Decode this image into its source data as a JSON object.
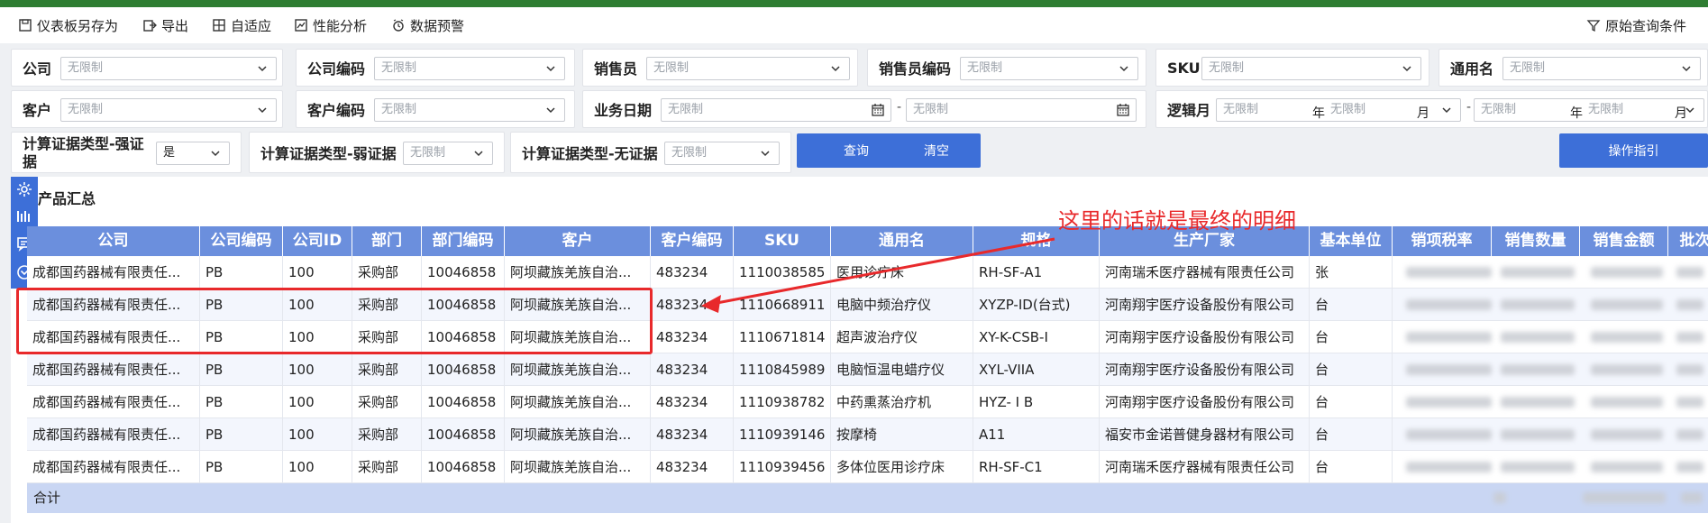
{
  "toolbar": {
    "save_dashboard": "仪表板另存为",
    "export": "导出",
    "adaptive": "自适应",
    "perf_analysis": "性能分析",
    "data_alert": "数据预警",
    "original_query": "原始查询条件"
  },
  "filters": {
    "placeholder": "无限制",
    "company": "公司",
    "company_code": "公司编码",
    "salesperson": "销售员",
    "salesperson_code": "销售员编码",
    "sku": "SKU",
    "generic_name": "通用名",
    "customer": "客户",
    "customer_code": "客户编码",
    "business_date": "业务日期",
    "logic_month": "逻辑月",
    "year_suffix": "年",
    "month_suffix": "月",
    "date_sep": "-",
    "strong_evidence_label_1": "计算证据类型-强证",
    "strong_evidence_label_2": "据",
    "strong_evidence_value": "是",
    "weak_evidence": "计算证据类型-弱证据",
    "no_evidence": "计算证据类型-无证据",
    "query_button": "查询",
    "clear_button": "清空",
    "guide_button": "操作指引"
  },
  "panel": {
    "title": "产品汇总",
    "columns": [
      "公司",
      "公司编码",
      "公司ID",
      "部门",
      "部门编码",
      "客户",
      "客户编码",
      "SKU",
      "通用名",
      "规格",
      "生产厂家",
      "基本单位",
      "销项税率",
      "销售数量",
      "销售金额",
      "批次"
    ],
    "rows": [
      [
        "成都国药器械有限责任...",
        "PB",
        "100",
        "采购部",
        "10046858",
        "阿坝藏族羌族自治...",
        "483234",
        "1110038585",
        "医用诊疗床",
        "RH-SF-A1",
        "河南瑞禾医疗器械有限责任公司",
        "张"
      ],
      [
        "成都国药器械有限责任...",
        "PB",
        "100",
        "采购部",
        "10046858",
        "阿坝藏族羌族自治...",
        "483234",
        "1110668911",
        "电脑中频治疗仪",
        "XYZP-ID(台式)",
        "河南翔宇医疗设备股份有限公司",
        "台"
      ],
      [
        "成都国药器械有限责任...",
        "PB",
        "100",
        "采购部",
        "10046858",
        "阿坝藏族羌族自治...",
        "483234",
        "1110671814",
        "超声波治疗仪",
        "XY-K-CSB-I",
        "河南翔宇医疗设备股份有限公司",
        "台"
      ],
      [
        "成都国药器械有限责任...",
        "PB",
        "100",
        "采购部",
        "10046858",
        "阿坝藏族羌族自治...",
        "483234",
        "1110845989",
        "电脑恒温电蜡疗仪",
        "XYL-VIIA",
        "河南翔宇医疗设备股份有限公司",
        "台"
      ],
      [
        "成都国药器械有限责任...",
        "PB",
        "100",
        "采购部",
        "10046858",
        "阿坝藏族羌族自治...",
        "483234",
        "1110938782",
        "中药熏蒸治疗机",
        "HYZ- I B",
        "河南翔宇医疗设备股份有限公司",
        "台"
      ],
      [
        "成都国药器械有限责任...",
        "PB",
        "100",
        "采购部",
        "10046858",
        "阿坝藏族羌族自治...",
        "483234",
        "1110939146",
        "按摩椅",
        "A11",
        "福安市金诺普健身器材有限公司",
        "台"
      ],
      [
        "成都国药器械有限责任...",
        "PB",
        "100",
        "采购部",
        "10046858",
        "阿坝藏族羌族自治...",
        "483234",
        "1110939456",
        "多体位医用诊疗床",
        "RH-SF-C1",
        "河南瑞禾医疗器械有限责任公司",
        "台"
      ]
    ],
    "total_label": "合计"
  },
  "annotation": {
    "text": "这里的话就是最终的明细",
    "color": "#e8292b"
  },
  "colors": {
    "accent": "#3d6fd8",
    "header": "#6b8fdd",
    "total_row": "#c9d6f3",
    "top_strip": "#2e7d32"
  }
}
